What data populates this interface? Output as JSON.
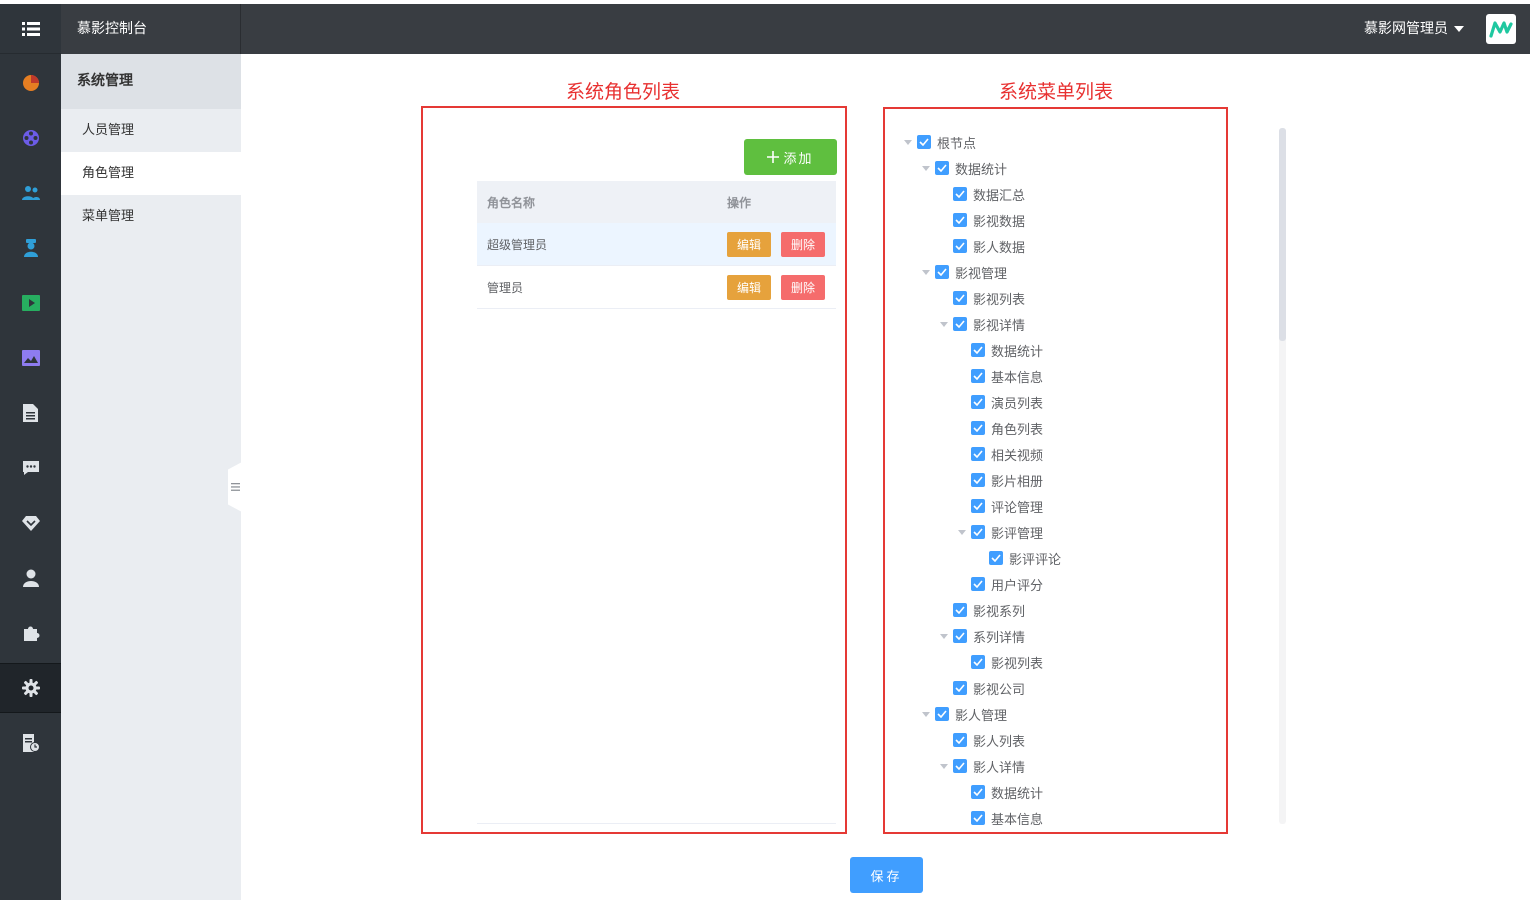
{
  "header": {
    "brand": "慕影控制台",
    "user": "慕影网管理员"
  },
  "rail_icons": [
    "chart-pie-icon",
    "film-reel-icon",
    "users-icon",
    "actor-icon",
    "video-play-icon",
    "image-icon",
    "document-icon",
    "comment-icon",
    "diamond-icon",
    "user-icon",
    "puzzle-icon",
    "settings-icon",
    "report-icon"
  ],
  "subnav": {
    "section": "系统管理",
    "items": [
      "人员管理",
      "角色管理",
      "菜单管理"
    ],
    "active": "角色管理"
  },
  "roles_panel": {
    "title": "系统角色列表",
    "add_label": "添加",
    "columns": [
      "角色名称",
      "操作"
    ],
    "rows": [
      {
        "name": "超级管理员",
        "edit": "编辑",
        "delete": "删除"
      },
      {
        "name": "管理员",
        "edit": "编辑",
        "delete": "删除"
      }
    ]
  },
  "menu_panel": {
    "title": "系统菜单列表",
    "tree": [
      {
        "label": "根节点",
        "level": 0,
        "expanded": true,
        "checked": true
      },
      {
        "label": "数据统计",
        "level": 1,
        "expanded": true,
        "checked": true
      },
      {
        "label": "数据汇总",
        "level": 2,
        "checked": true
      },
      {
        "label": "影视数据",
        "level": 2,
        "checked": true
      },
      {
        "label": "影人数据",
        "level": 2,
        "checked": true
      },
      {
        "label": "影视管理",
        "level": 1,
        "expanded": true,
        "checked": true
      },
      {
        "label": "影视列表",
        "level": 2,
        "checked": true
      },
      {
        "label": "影视详情",
        "level": 2,
        "expanded": true,
        "checked": true
      },
      {
        "label": "数据统计",
        "level": 3,
        "checked": true
      },
      {
        "label": "基本信息",
        "level": 3,
        "checked": true
      },
      {
        "label": "演员列表",
        "level": 3,
        "checked": true
      },
      {
        "label": "角色列表",
        "level": 3,
        "checked": true
      },
      {
        "label": "相关视频",
        "level": 3,
        "checked": true
      },
      {
        "label": "影片相册",
        "level": 3,
        "checked": true
      },
      {
        "label": "评论管理",
        "level": 3,
        "checked": true
      },
      {
        "label": "影评管理",
        "level": 3,
        "expanded": true,
        "checked": true
      },
      {
        "label": "影评评论",
        "level": 4,
        "checked": true
      },
      {
        "label": "用户评分",
        "level": 3,
        "checked": true
      },
      {
        "label": "影视系列",
        "level": 2,
        "checked": true
      },
      {
        "label": "系列详情",
        "level": 2,
        "expanded": true,
        "checked": true
      },
      {
        "label": "影视列表",
        "level": 3,
        "checked": true
      },
      {
        "label": "影视公司",
        "level": 2,
        "checked": true
      },
      {
        "label": "影人管理",
        "level": 1,
        "expanded": true,
        "checked": true
      },
      {
        "label": "影人列表",
        "level": 2,
        "checked": true
      },
      {
        "label": "影人详情",
        "level": 2,
        "expanded": true,
        "checked": true
      },
      {
        "label": "数据统计",
        "level": 3,
        "checked": true
      },
      {
        "label": "基本信息",
        "level": 3,
        "checked": true
      }
    ]
  },
  "save_label": "保存",
  "colors": {
    "rail": "#2f353b",
    "header": "#393d42",
    "primary": "#409eff",
    "add": "#5fbf3f",
    "edit": "#e6a23c",
    "delete": "#f56c6c",
    "highlight": "#e53935"
  }
}
